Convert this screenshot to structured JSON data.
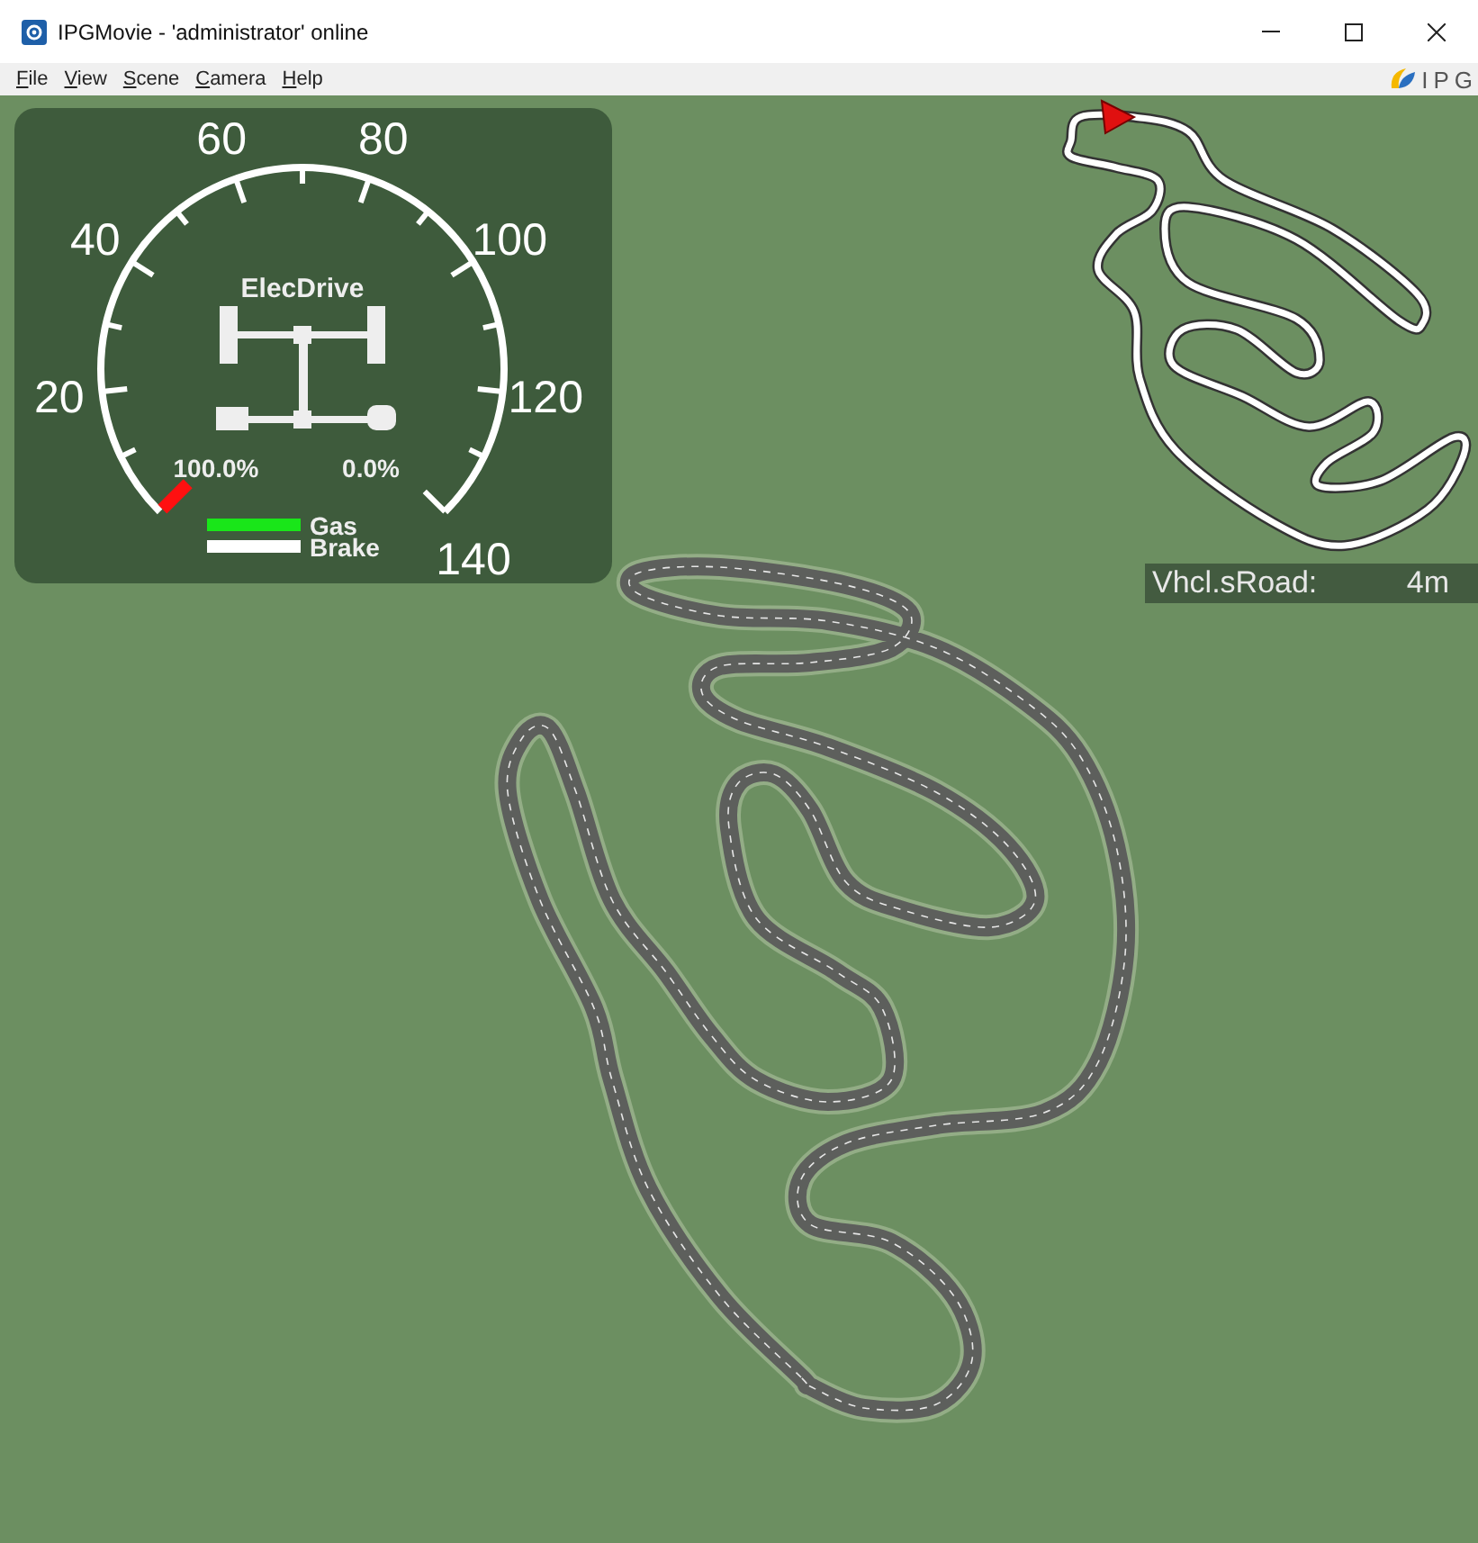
{
  "window": {
    "title": "IPGMovie - 'administrator' online"
  },
  "menu": [
    "File",
    "View",
    "Scene",
    "Camera",
    "Help"
  ],
  "logo": {
    "text": "IPG"
  },
  "gauge": {
    "scale_labels": [
      "20",
      "40",
      "60",
      "80",
      "100",
      "120",
      "140"
    ],
    "mode": "ElecDrive",
    "readings": [
      "100.0%",
      "0.0%"
    ],
    "bars": [
      {
        "label": "Gas",
        "color": "#19e619"
      },
      {
        "label": "Brake",
        "color": "#ffffff"
      }
    ]
  },
  "road_info": {
    "label": "Vhcl.sRoad:",
    "value": "4m"
  }
}
